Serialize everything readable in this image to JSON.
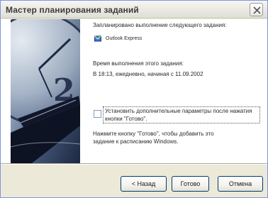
{
  "window": {
    "title": "Мастер планирования заданий"
  },
  "content": {
    "intro_line": "Запланировано выполнение следующего задания:",
    "task_name": "Outlook Express",
    "time_heading": "Время выполнения этого задания:",
    "time_value": "В 18:13, ежедневно, начиная с 11.09.2002",
    "advanced_checkbox": {
      "checked": false,
      "label": "Установить дополнительные параметры после нажатия кнопки \"Готово\"."
    },
    "footer_line1": "Нажмите кнопку \"Готово\", чтобы добавить это",
    "footer_line2": "задание к расписанию Windows."
  },
  "buttons": {
    "back": "< Назад",
    "done": "Готово",
    "cancel": "Отмена"
  },
  "colors": {
    "title_bar": "#ecebe4",
    "dialog_bg": "#ece9d8",
    "content_bg": "#ffffff",
    "button_border": "#003c74"
  },
  "icons": {
    "close": "close-icon",
    "task": "outlook-express-icon",
    "side": "clock-and-pen-illustration"
  }
}
